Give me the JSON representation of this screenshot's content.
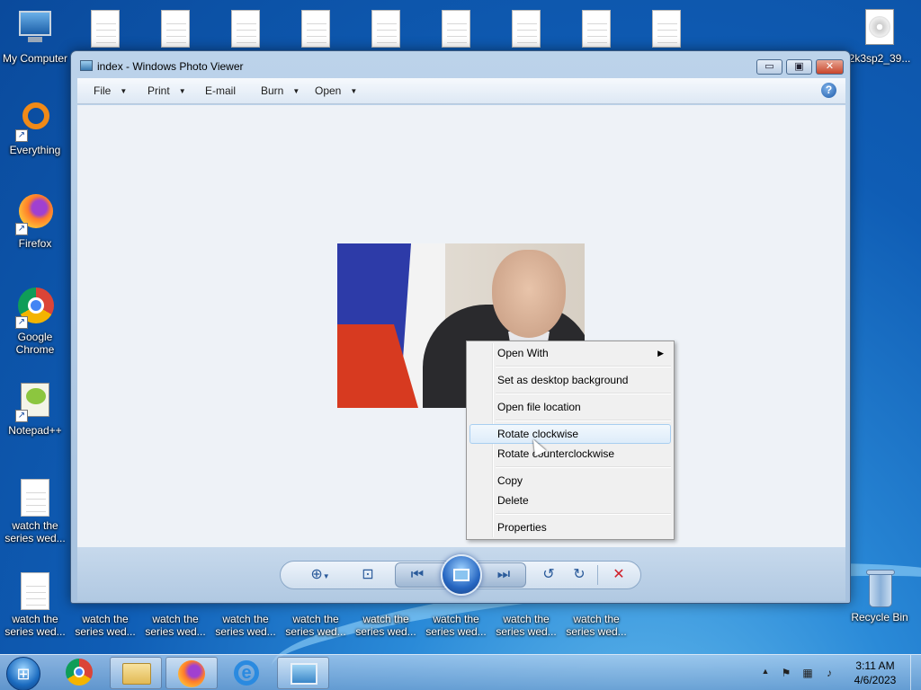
{
  "desktop": {
    "icons": {
      "my_computer": "My Computer",
      "everything": "Everything",
      "firefox": "Firefox",
      "chrome_line1": "Google",
      "chrome_line2": "Chrome",
      "notepadpp": "Notepad++",
      "iso_file": "2k3sp2_39...",
      "recycle_bin": "Recycle Bin",
      "watch_line1": "watch the",
      "watch_line2": "series wed..."
    }
  },
  "window": {
    "title": "index - Windows Photo Viewer",
    "controls": {
      "minimize": "▭",
      "maximize": "▣",
      "close": "✕"
    },
    "menu": {
      "file": "File",
      "print": "Print",
      "email": "E-mail",
      "burn": "Burn",
      "open": "Open",
      "help_icon": "?"
    }
  },
  "context_menu": {
    "open_with": "Open With",
    "set_desktop_background": "Set as desktop background",
    "open_file_location": "Open file location",
    "rotate_clockwise": "Rotate clockwise",
    "rotate_counterclockwise": "Rotate counterclockwise",
    "copy": "Copy",
    "delete": "Delete",
    "properties": "Properties"
  },
  "toolbar": {
    "zoom_icon": "⊕",
    "actual_size_icon": "⊡",
    "previous_icon": "⏮",
    "next_icon": "⏭",
    "rotate_ccw_icon": "↺",
    "rotate_cw_icon": "↻",
    "delete_icon": "✕"
  },
  "taskbar": {
    "time": "3:11 AM",
    "date": "4/6/2023"
  },
  "colors": {
    "delete_red": "#d0202a",
    "accent_blue": "#2a5a9a"
  }
}
